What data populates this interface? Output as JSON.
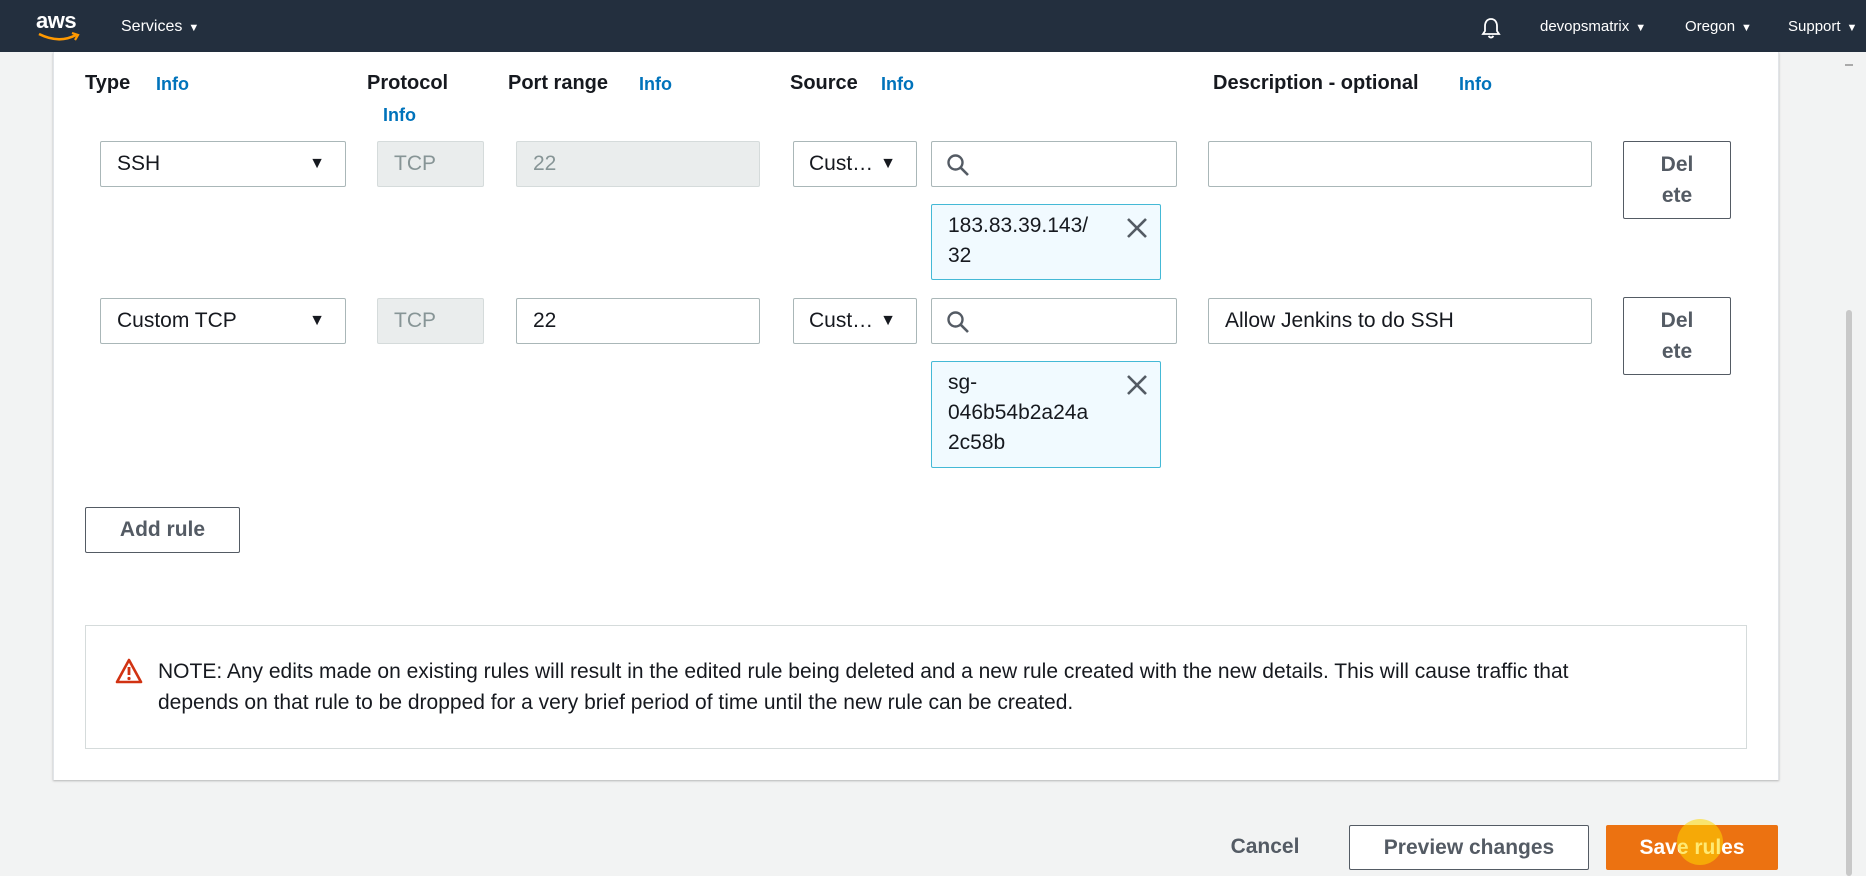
{
  "nav": {
    "logo_text": "aws",
    "services": "Services",
    "account": "devopsmatrix",
    "region": "Oregon",
    "support": "Support",
    "icons": [
      "aws-logo",
      "bell-icon",
      "caret-down-icon"
    ]
  },
  "columns": {
    "type": "Type",
    "protocol": "Protocol",
    "port_range": "Port range",
    "source": "Source",
    "description": "Description - optional",
    "info": "Info"
  },
  "rules": [
    {
      "type": "SSH",
      "protocol": "TCP",
      "port": "22",
      "source_mode": "Cust…",
      "search_value": "",
      "chip_lines": [
        "183.83.39.143/",
        "32"
      ],
      "description": "",
      "delete_lines": [
        "Del",
        "ete"
      ]
    },
    {
      "type": "Custom TCP",
      "protocol": "TCP",
      "port": "22",
      "source_mode": "Cust…",
      "search_value": "",
      "chip_lines": [
        "sg-",
        "046b54b2a24a",
        "2c58b"
      ],
      "description": "Allow Jenkins to do SSH",
      "delete_lines": [
        "Del",
        "ete"
      ]
    }
  ],
  "add_rule": "Add rule",
  "note": {
    "line1": "NOTE: Any edits made on existing rules will result in the edited rule being deleted and a new rule created with the new details. This will cause traffic that",
    "line2": "depends on that rule to be dropped for a very brief period of time until the new rule can be created."
  },
  "footer": {
    "cancel": "Cancel",
    "preview": "Preview changes",
    "save": "Save rules"
  },
  "colors": {
    "nav_bg": "#232f3e",
    "link": "#0073bb",
    "primary": "#ec7211",
    "chip_border": "#44b9d6",
    "warning": "#d13212"
  }
}
